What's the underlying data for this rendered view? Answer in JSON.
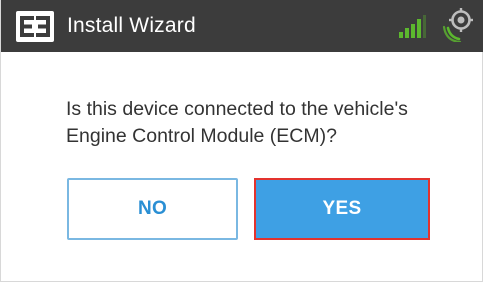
{
  "header": {
    "title": "Install Wizard",
    "logo_icon": "eroad-logo-icon",
    "signal_icon": "cellular-signal-icon",
    "gps_icon": "gps-location-icon",
    "bg_color": "#3c3c3c",
    "signal_color": "#5cb82e",
    "gps_color": "#5cb82e"
  },
  "dialog": {
    "question": "Is this device connected to the vehicle's Engine Control Module (ECM)?",
    "no_label": "NO",
    "yes_label": "YES",
    "accent_color": "#3ea0e4",
    "highlight_color": "#e3332e"
  }
}
